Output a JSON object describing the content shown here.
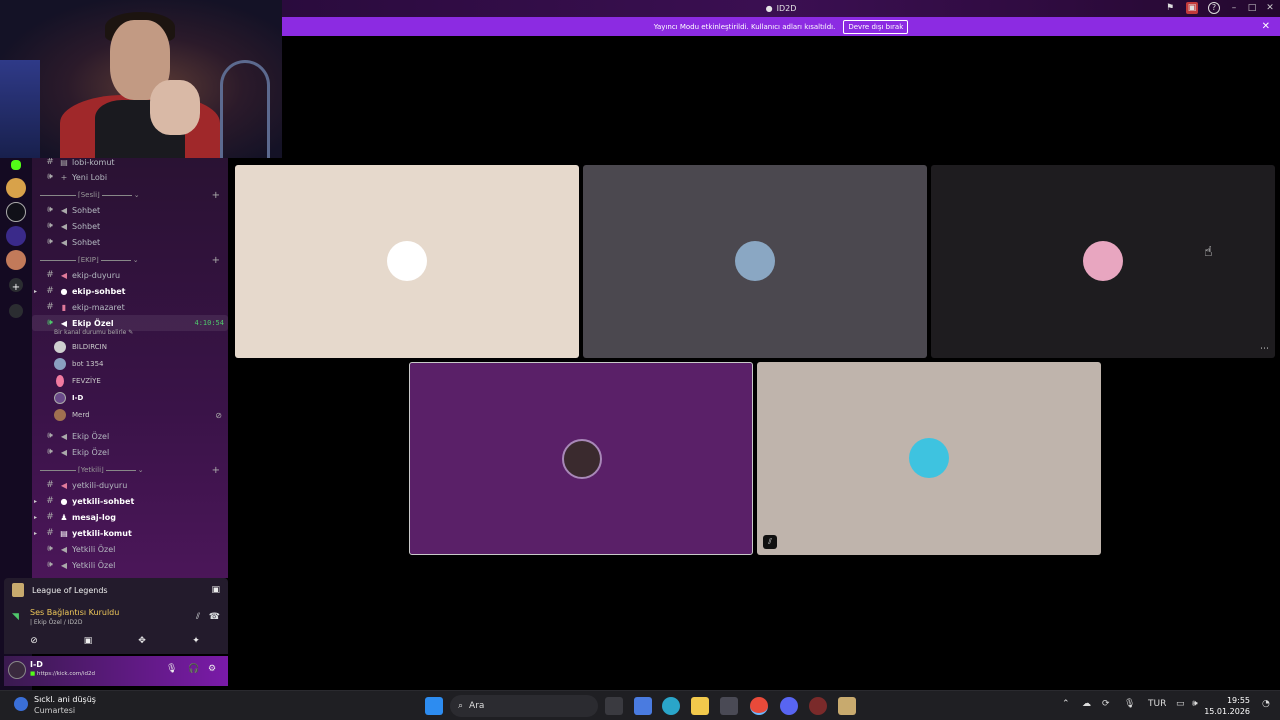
{
  "window": {
    "title": "ID2D"
  },
  "banner": {
    "message": "Yayıncı Modu etkinleştirildi. Kullanıcı adları kısaltıldı.",
    "button": "Devre dışı bırak"
  },
  "channels": [
    {
      "name": "lobi-komut",
      "bold": false
    },
    {
      "name": "Yeni Lobi",
      "bold": false
    },
    {
      "name": "Sohbet",
      "bold": false
    },
    {
      "name": "Sohbet",
      "bold": false
    },
    {
      "name": "Sohbet",
      "bold": false
    },
    {
      "name": "ekip-duyuru",
      "bold": false
    },
    {
      "name": "ekip-sohbet",
      "bold": true
    },
    {
      "name": "ekip-mazaret",
      "bold": false
    },
    {
      "name": "Ekip Özel",
      "bold": true
    },
    {
      "name": "Ekip Özel",
      "bold": false
    },
    {
      "name": "Ekip Özel",
      "bold": false
    },
    {
      "name": "yetkili-duyuru",
      "bold": false
    },
    {
      "name": "yetkili-sohbet",
      "bold": true
    },
    {
      "name": "mesaj-log",
      "bold": true
    },
    {
      "name": "yetkili-komut",
      "bold": true
    },
    {
      "name": "Yetkili Özel",
      "bold": false
    },
    {
      "name": "Yetkili Özel",
      "bold": false
    }
  ],
  "categories": {
    "sesli": "⌈Sesli⌋",
    "ekip": "⌈EKIP⌋",
    "yetkili": "⌈Yetkili⌋"
  },
  "active_channel": {
    "timer": "4:10:54",
    "status": "Bir kanal durumu belirle"
  },
  "members": [
    {
      "name": "BILDIRCIN",
      "color": "#cfcfcf"
    },
    {
      "name": "bot 1354",
      "color": "#8aa0c0"
    },
    {
      "name": "FEVZİYE",
      "color": "#f07aa0"
    },
    {
      "name": "I-D",
      "color": "#6a4a8a"
    },
    {
      "name": "Merd",
      "color": "#a07050"
    }
  ],
  "activity": {
    "game": "League of Legends"
  },
  "voice": {
    "status": "Ses Bağlantısı Kuruldu",
    "location": "| Ekip Özel / ID2D"
  },
  "user": {
    "name": "I-D",
    "status": "https://kick.com/id2d"
  },
  "tiles": [
    {
      "bg": "#e6d9cc",
      "avatar_bg": "#ffffff"
    },
    {
      "bg": "#4b484f",
      "avatar_bg": "#8aa7c3"
    },
    {
      "bg": "#1e1c1f",
      "avatar_bg": "#e8a6c0"
    },
    {
      "bg": "#5a2068",
      "avatar_bg": "#3a2a2e"
    },
    {
      "bg": "#bfb4ac",
      "avatar_bg": "#3ec3e0"
    }
  ],
  "taskbar": {
    "weather_title": "Sıckl. ani düşüş",
    "weather_sub": "Cumartesi",
    "search_placeholder": "Ara",
    "lang": "TUR",
    "time": "19:55",
    "date": "15.01.2026"
  }
}
